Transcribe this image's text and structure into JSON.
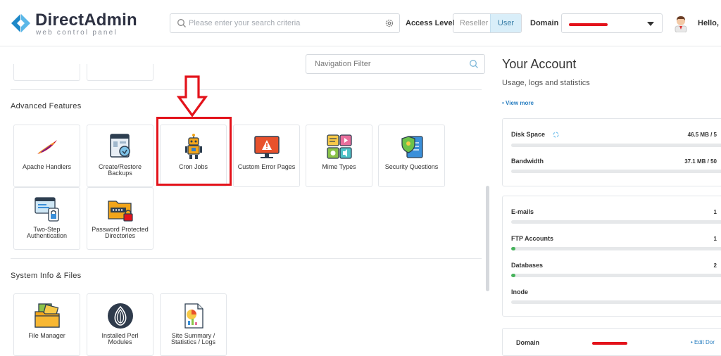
{
  "header": {
    "brand": "DirectAdmin",
    "brand_sub": "web control panel",
    "search_placeholder": "Please enter your search criteria",
    "access_level_label": "Access Level",
    "access_levels": [
      "Reseller",
      "User"
    ],
    "active_access_level": "User",
    "domain_label": "Domain",
    "greeting": "Hello, I"
  },
  "navigation": {
    "filter_placeholder": "Navigation Filter"
  },
  "sections": [
    {
      "title": "Advanced Features",
      "items": [
        {
          "label": "Apache Handlers",
          "icon": "feather-icon"
        },
        {
          "label": "Create/Restore Backups",
          "icon": "backup-icon"
        },
        {
          "label": "Cron Jobs",
          "icon": "robot-icon"
        },
        {
          "label": "Custom Error Pages",
          "icon": "warning-monitor-icon"
        },
        {
          "label": "Mime Types",
          "icon": "media-types-icon"
        },
        {
          "label": "Security Questions",
          "icon": "shield-document-icon"
        },
        {
          "label": "Two-Step Authentication",
          "icon": "two-step-auth-icon"
        },
        {
          "label": "Password Protected Directories",
          "icon": "locked-folder-icon"
        }
      ]
    },
    {
      "title": "System Info & Files",
      "items": [
        {
          "label": "File Manager",
          "icon": "file-manager-icon"
        },
        {
          "label": "Installed Perl Modules",
          "icon": "perl-onion-icon"
        },
        {
          "label": "Site Summary / Statistics / Logs",
          "icon": "statistics-report-icon"
        }
      ]
    }
  ],
  "account": {
    "title": "Your Account",
    "subtitle": "Usage, logs and statistics",
    "view_more": "• View more",
    "usage": [
      {
        "label": "Disk Space",
        "value": "46.5 MB / 5",
        "fraction": 0.0
      },
      {
        "label": "Bandwidth",
        "value": "37.1 MB / 50",
        "fraction": 0.0
      }
    ],
    "counts": [
      {
        "label": "E-mails",
        "value": "1",
        "fraction": 0.0
      },
      {
        "label": "FTP Accounts",
        "value": "1",
        "fraction": 0.02
      },
      {
        "label": "Databases",
        "value": "2",
        "fraction": 0.02
      },
      {
        "label": "Inode",
        "value": "",
        "fraction": 0.0
      }
    ],
    "domain_label": "Domain",
    "edit_domain": "• Edit Dor"
  },
  "colors": {
    "accent_blue": "#2a7fc1",
    "active_tab_bg": "#d9eef9",
    "annotation_red": "#e3131b",
    "progress_green": "#47b35c"
  }
}
